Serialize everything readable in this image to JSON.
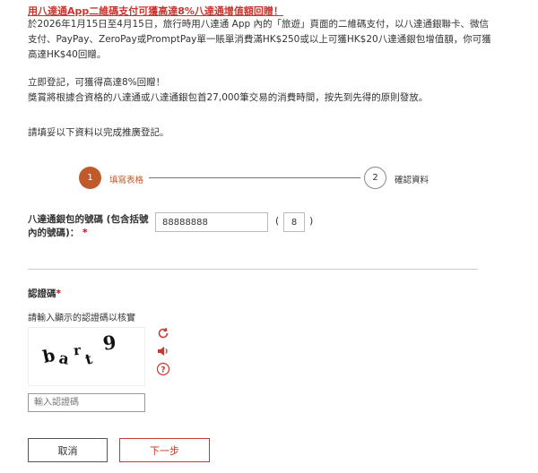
{
  "promo": {
    "title": "用八達通App二維碼支付可獲高達8%八達通增值額回贈！",
    "body_lines": [
      "於2026年1月15日至4月15日，旅行時用八達通 App 內的「旅遊」頁面的二維碼支付，以八達通銀聯卡、微信",
      "支付、PayPay、ZeroPay或PromptPay單一賬單消費滿HK$250或以上可獲HK$20八達通銀包增值額，你可獲",
      "高達HK$40回贈。"
    ]
  },
  "register": {
    "line1": "立即登記，可獲得高達8%回贈！",
    "line2": "獎賞將根據合資格的八達通或八達通銀包首27,000筆交易的消費時間，按先到先得的原則發放。"
  },
  "instruction": "請填妥以下資料以完成推廣登記。",
  "stepper": {
    "steps": [
      {
        "number": "1",
        "label": "填寫表格",
        "active": true
      },
      {
        "number": "2",
        "label": "確認資料",
        "active": false
      }
    ]
  },
  "card_field": {
    "label": "八達通銀包的號碼 (包含括號內的號碼)：",
    "required_mark": "*",
    "value": "88888888",
    "paren_open": "(",
    "check_digit": "8",
    "paren_close": ")"
  },
  "captcha": {
    "title": "認證碼",
    "required_mark": "*",
    "hint": "請輸入顯示的認證碼以核實",
    "image_text": [
      "b",
      "a",
      "r",
      "t",
      "9"
    ],
    "input_placeholder": "輸入認證碼",
    "icons": [
      "refresh-icon",
      "speaker-icon",
      "help-icon"
    ]
  },
  "buttons": {
    "cancel": "取消",
    "next": "下一步"
  },
  "colors": {
    "accent": "#c8372d",
    "step_active": "#c05a2a",
    "required": "#d0021b"
  }
}
